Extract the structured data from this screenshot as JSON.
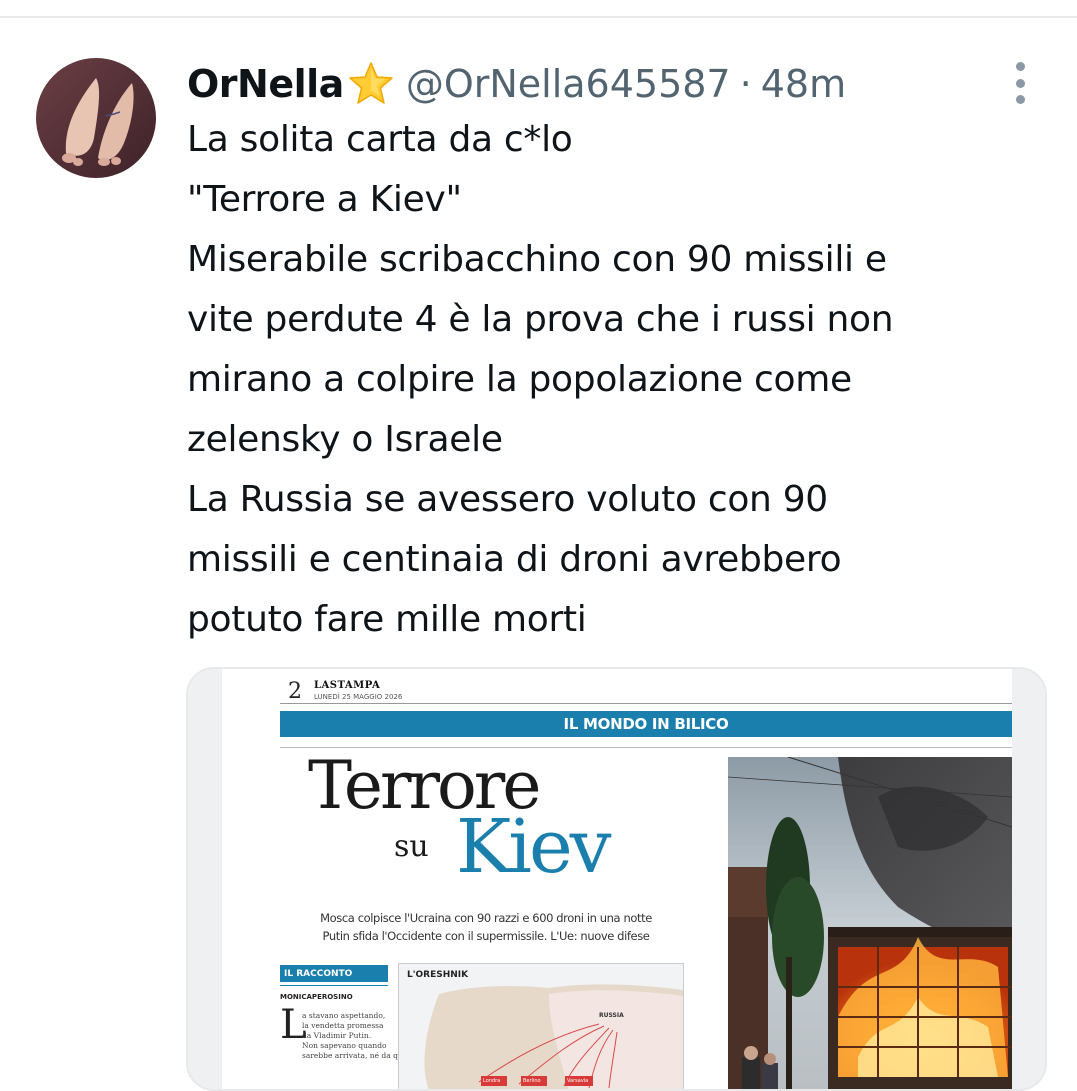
{
  "author": {
    "display_name": "OrNella",
    "verified_emoji": "star-emoji",
    "handle": "@OrNella645587",
    "separator": "·",
    "time": "48m"
  },
  "tweet": {
    "lines": [
      "La solita carta da c*lo",
      "\"Terrore a Kiev\"",
      "Miserabile scribacchino con 90 missili e",
      "vite perdute 4 è la prova che i russi non",
      "mirano a colpire la popolazione come",
      "zelensky o Israele",
      "La Russia se avessero voluto con 90",
      "missili e centinaia di droni avrebbero",
      "potuto fare mille morti"
    ]
  },
  "media": {
    "page_number": "2",
    "masthead": "LASTAMPA",
    "date": "LUNEDÌ 25 MAGGIO 2026",
    "section": "IL MONDO IN BILICO",
    "headline_line1": "Terrore",
    "headline_su": "su",
    "headline_city": "Kiev",
    "standfirst": [
      "Mosca colpisce l'Ucraina con 90 razzi e 600 droni in una notte",
      "Putin sfida l'Occidente con il supermissile. L'Ue: nuove difese"
    ],
    "kicker": "IL RACCONTO",
    "byline": "MONICAPEROSINO",
    "dropcap": "L",
    "body_lines": [
      "a stavano aspettando,",
      "la vendetta promessa",
      "da Vladimir Putin.",
      "Non sapevano quando",
      "sarebbe arrivata, né da quale"
    ],
    "map_title": "L'ORESHNIK",
    "map_label_russia": "RUSSIA",
    "map_cities": [
      "Londra",
      "Berlino",
      "Varsavia"
    ]
  },
  "icons": {
    "more": "more-options-icon",
    "star": "star-icon"
  },
  "colors": {
    "text_primary": "#0f1419",
    "text_secondary": "#536471",
    "paper_accent": "#1b7fae",
    "divider": "#e7e9ea"
  }
}
